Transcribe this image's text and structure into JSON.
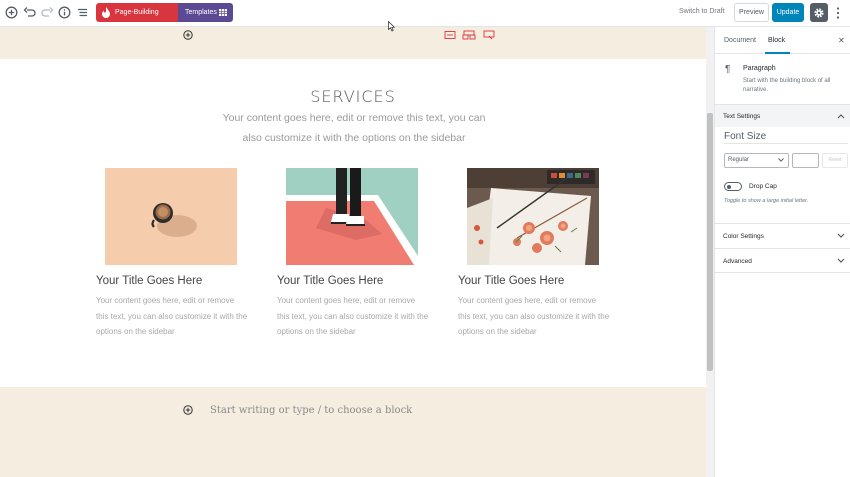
{
  "toolbar": {
    "page_building_mode": "Page-Building Mode",
    "templates": "Templates",
    "switch_to_draft": "Switch to Draft",
    "preview": "Preview",
    "update": "Update"
  },
  "canvas": {
    "services_title": "SERVICES",
    "services_subtitle": "Your content goes here, edit or remove this text, you can also customize it with the options on the sidebar",
    "cards": [
      {
        "title": "Your Title Goes Here",
        "description": "Your content goes here, edit or remove this text, you can also customize it with the options on the sidebar"
      },
      {
        "title": "Your Title Goes Here",
        "description": "Your content goes here, edit or remove this text, you can also customize it with the options on the sidebar"
      },
      {
        "title": "Your Title Goes Here",
        "description": "Your content goes here, edit or remove this text, you can also customize it with the options on the sidebar"
      }
    ],
    "placeholder": "Start writing or type / to choose a block"
  },
  "sidebar": {
    "tabs": [
      "Document",
      "Block"
    ],
    "active_tab": "Block",
    "block_name": "Paragraph",
    "block_description": "Start with the building block of all narrative.",
    "text_settings": "Text Settings",
    "font_size_label": "Font Size",
    "font_size_select": "Regular",
    "reset": "Reset",
    "drop_cap_label": "Drop Cap",
    "drop_cap_help": "Toggle to show a large initial letter.",
    "color_settings": "Color Settings",
    "advanced": "Advanced"
  },
  "colors": {
    "accent_blue": "#0085ba",
    "brand_red": "#d8353e",
    "brand_purple": "#5b4a93",
    "section_beige": "#f4ede0"
  }
}
